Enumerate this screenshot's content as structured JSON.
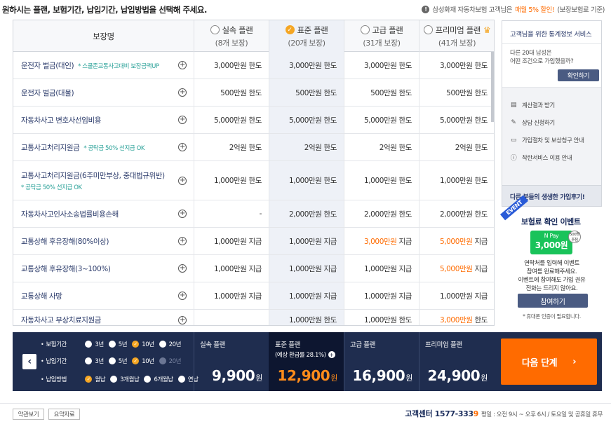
{
  "header": {
    "instruction": "원하시는 플랜, 보험기간, 납입기간, 납입방법을 선택해 주세요.",
    "note_prefix": "삼성화재 자동차보험 고객님은",
    "note_highlight": "매월 5% 할인!",
    "note_suffix": "(보장보험료 기준)"
  },
  "table": {
    "header_label": "보장명",
    "plans": [
      {
        "name": "실속 플랜",
        "count": "(8개 보장)",
        "selected": false,
        "crown": false
      },
      {
        "name": "표준 플랜",
        "count": "(20개 보장)",
        "selected": true,
        "crown": false
      },
      {
        "name": "고급 플랜",
        "count": "(31개 보장)",
        "selected": false,
        "crown": false
      },
      {
        "name": "프리미엄 플랜",
        "count": "(41개 보장)",
        "selected": false,
        "crown": true
      }
    ],
    "rows": [
      {
        "name": "운전자 벌금(대인)",
        "note": "* 스쿨존교통사고대비 보장금액UP",
        "cells": [
          "3,000만원 한도",
          "3,000만원 한도",
          "3,000만원 한도",
          "3,000만원 한도"
        ],
        "highlight": [
          false,
          false,
          false,
          false
        ]
      },
      {
        "name": "운전자 벌금(대물)",
        "note": "",
        "cells": [
          "500만원 한도",
          "500만원 한도",
          "500만원 한도",
          "500만원 한도"
        ],
        "highlight": [
          false,
          false,
          false,
          false
        ]
      },
      {
        "name": "자동차사고 변호사선임비용",
        "note": "",
        "cells": [
          "5,000만원 한도",
          "5,000만원 한도",
          "5,000만원 한도",
          "5,000만원 한도"
        ],
        "highlight": [
          false,
          false,
          false,
          false
        ]
      },
      {
        "name": "교통사고처리지원금",
        "note": "* 공탁금 50% 선지급 OK",
        "cells": [
          "2억원 한도",
          "2억원 한도",
          "2억원 한도",
          "2억원 한도"
        ],
        "highlight": [
          false,
          false,
          false,
          false
        ]
      },
      {
        "name": "교통사고처리지원금(6주미만부상, 중대법규위반)",
        "note2": "* 공탁금 50% 선지급 OK",
        "cells": [
          "1,000만원 한도",
          "1,000만원 한도",
          "1,000만원 한도",
          "1,000만원 한도"
        ],
        "highlight": [
          false,
          false,
          false,
          false
        ]
      },
      {
        "name": "자동차사고인사소송법률비용손해",
        "note": "",
        "cells": [
          "-",
          "2,000만원 한도",
          "2,000만원 한도",
          "2,000만원 한도"
        ],
        "highlight": [
          false,
          false,
          false,
          false
        ]
      },
      {
        "name": "교통상해 후유장해(80%이상)",
        "note": "",
        "cells": [
          "1,000만원 지급",
          "1,000만원 지급",
          "3,000만원 지급",
          "5,000만원 지급"
        ],
        "highlight": [
          false,
          false,
          true,
          true
        ]
      },
      {
        "name": "교통상해 후유장해(3~100%)",
        "note": "",
        "cells": [
          "1,000만원 지급",
          "1,000만원 지급",
          "1,000만원 지급",
          "5,000만원 지급"
        ],
        "highlight": [
          false,
          false,
          false,
          true
        ]
      },
      {
        "name": "교통상해 사망",
        "note": "",
        "cells": [
          "1,000만원 지급",
          "1,000만원 지급",
          "1,000만원 지급",
          "1,000만원 지급"
        ],
        "highlight": [
          false,
          false,
          false,
          false
        ]
      },
      {
        "name": "자동차사고 부상치료지원금",
        "note": "",
        "cells": [
          "",
          "1,000만원 한도",
          "1,000만원 한도",
          "3,000만원 한도"
        ],
        "highlight": [
          false,
          false,
          false,
          true
        ]
      }
    ]
  },
  "side_panel": {
    "title": "고객님을 위한 통계정보 서비스",
    "subtitle_line1": "다른 20대 남성은",
    "subtitle_line2": "어떤 조건으로 가입했을까?",
    "confirm_label": "확인하기",
    "links": [
      {
        "icon": "document-icon",
        "label": "계산결과 받기"
      },
      {
        "icon": "edit-icon",
        "label": "상담 신청하기"
      },
      {
        "icon": "book-icon",
        "label": "가입절차 및 보상청구 안내"
      },
      {
        "icon": "info-icon",
        "label": "착한서비스 이용 안내"
      }
    ],
    "bottom_label": "다른 분들의 생생한 가입후기!"
  },
  "event": {
    "ribbon": "EVENT",
    "title": "보험료 확인 이벤트",
    "pay_brand": "N Pay",
    "pay_amount": "3,000원",
    "badge_line1": "500명",
    "badge_line2": "추첨",
    "desc_line1": "연락처를 입력해 이벤트",
    "desc_line2": "참여를 완료해주세요.",
    "desc_line3": "이벤트에 참여해도 가입 권유",
    "desc_line4": "전화는 드리지 않아요.",
    "button_label": "참여하기",
    "note": "* 휴대폰 인증이 필요합니다."
  },
  "bottom_bar": {
    "options": [
      {
        "label": "보험기간",
        "choices": [
          {
            "text": "3년",
            "state": "off"
          },
          {
            "text": "5년",
            "state": "off"
          },
          {
            "text": "10년",
            "state": "on"
          },
          {
            "text": "20년",
            "state": "off"
          }
        ]
      },
      {
        "label": "납입기간",
        "choices": [
          {
            "text": "3년",
            "state": "off"
          },
          {
            "text": "5년",
            "state": "off"
          },
          {
            "text": "10년",
            "state": "on"
          },
          {
            "text": "20년",
            "state": "disabled"
          }
        ]
      },
      {
        "label": "납입방법",
        "choices": [
          {
            "text": "월납",
            "state": "on"
          },
          {
            "text": "3개월납",
            "state": "off"
          },
          {
            "text": "6개월납",
            "state": "off"
          },
          {
            "text": "연납",
            "state": "off"
          }
        ]
      }
    ],
    "prices": [
      {
        "name": "실속 플랜",
        "name2": "",
        "amount": "9,900",
        "unit": "원"
      },
      {
        "name": "표준 플랜",
        "name2": "(예상 환급률 28.1%)",
        "amount": "12,900",
        "unit": "원"
      },
      {
        "name": "고급 플랜",
        "name2": "",
        "amount": "16,900",
        "unit": "원"
      },
      {
        "name": "프리미엄 플랜",
        "name2": "",
        "amount": "24,900",
        "unit": "원"
      }
    ],
    "next_label": "다음 단계"
  },
  "footer": {
    "terms_label": "약관보기",
    "summary_label": "요약자료",
    "cs_title": "고객센터",
    "cs_number_main": "1577-333",
    "cs_number_last": "9",
    "cs_hours": "평일 : 오전 9시 ~ 오후 6시 / 토요일 및 공휴일 휴무"
  },
  "colors": {
    "accent": "#ff6b00",
    "navy": "#1f2d4f",
    "check": "#f5a623",
    "teal_note": "#2aa198"
  }
}
